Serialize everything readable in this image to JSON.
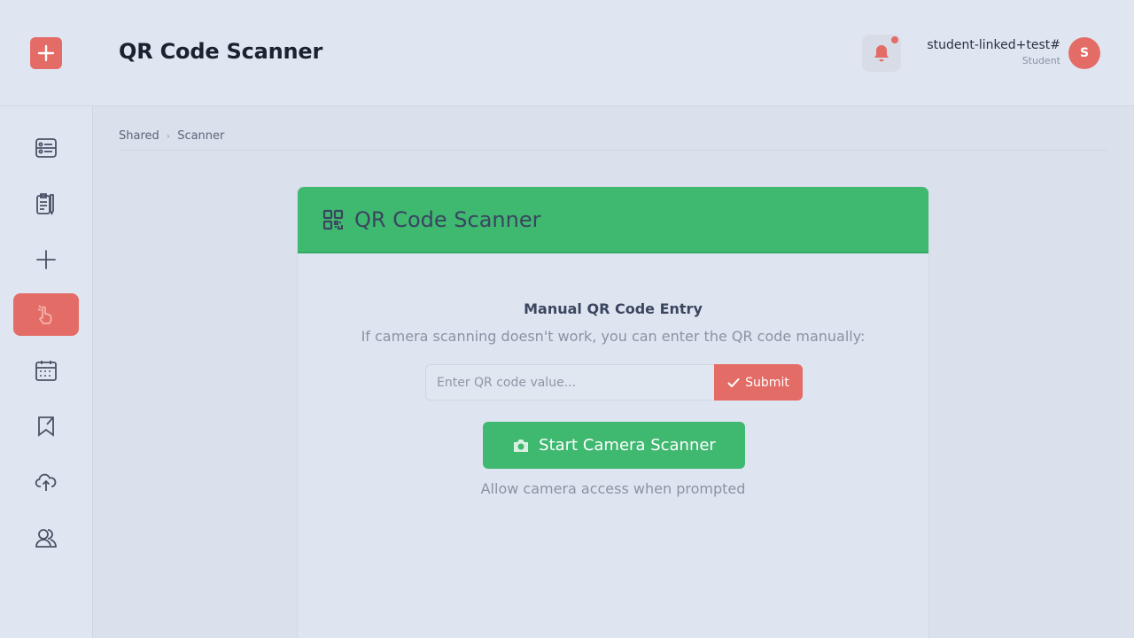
{
  "header": {
    "title": "QR Code Scanner",
    "user_name": "student-linked+test#",
    "user_role": "Student",
    "avatar_initial": "S"
  },
  "sidebar": {
    "items": [
      {
        "icon": "dashboard-icon"
      },
      {
        "icon": "clipboard-icon"
      },
      {
        "icon": "plus-icon"
      },
      {
        "icon": "hand-pointer-icon",
        "active": true
      },
      {
        "icon": "calendar-icon"
      },
      {
        "icon": "bookmark-icon"
      },
      {
        "icon": "cloud-upload-icon"
      },
      {
        "icon": "users-icon"
      }
    ]
  },
  "breadcrumb": {
    "items": [
      "Shared",
      "Scanner"
    ],
    "separator": "›"
  },
  "card": {
    "title": "QR Code Scanner",
    "manual_title": "Manual QR Code Entry",
    "manual_subtitle": "If camera scanning doesn't work, you can enter the QR code manually:",
    "input_placeholder": "Enter QR code value...",
    "submit_label": "Submit",
    "camera_button_label": "Start Camera Scanner",
    "camera_hint": "Allow camera access when prompted"
  },
  "colors": {
    "accent_red": "#e46c66",
    "accent_green": "#3fb870",
    "background": "#dde3ee"
  }
}
